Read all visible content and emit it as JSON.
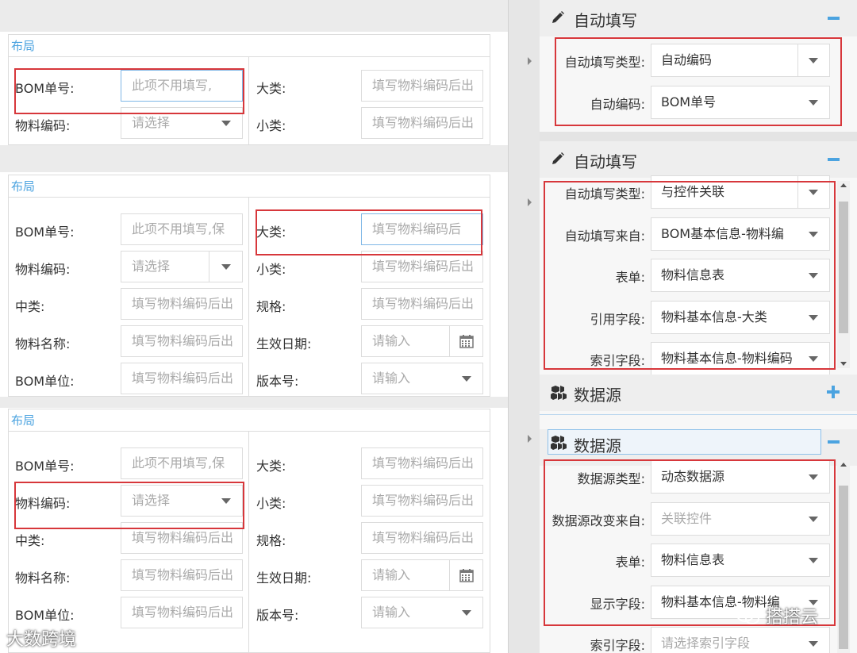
{
  "layout_title": "布局",
  "panels": [
    {
      "left": [
        {
          "label": "BOM单号:",
          "value": "此项不用填写,",
          "kind": "text",
          "focus": true
        },
        {
          "label": "物料编码:",
          "value": "请选择",
          "kind": "select"
        }
      ],
      "right": [
        {
          "label": "大类:",
          "value": "填写物料编码后出",
          "kind": "text"
        },
        {
          "label": "小类:",
          "value": "填写物料编码后出",
          "kind": "text"
        }
      ]
    },
    {
      "left": [
        {
          "label": "BOM单号:",
          "value": "此项不用填写,保",
          "kind": "text"
        },
        {
          "label": "物料编码:",
          "value": "请选择",
          "kind": "select-split"
        },
        {
          "label": "中类:",
          "value": "填写物料编码后出",
          "kind": "text"
        },
        {
          "label": "物料名称:",
          "value": "填写物料编码后出",
          "kind": "text"
        },
        {
          "label": "BOM单位:",
          "value": "填写物料编码后出",
          "kind": "text"
        }
      ],
      "right": [
        {
          "label": "大类:",
          "value": "填写物料编码后",
          "kind": "text",
          "focus": true
        },
        {
          "label": "小类:",
          "value": "填写物料编码后出",
          "kind": "text"
        },
        {
          "label": "规格:",
          "value": "填写物料编码后出",
          "kind": "text"
        },
        {
          "label": "生效日期:",
          "value": "请输入",
          "kind": "date"
        },
        {
          "label": "版本号:",
          "value": "请输入",
          "kind": "select"
        }
      ]
    },
    {
      "left": [
        {
          "label": "BOM单号:",
          "value": "此项不用填写,保",
          "kind": "text"
        },
        {
          "label": "物料编码:",
          "value": "请选择",
          "kind": "select"
        },
        {
          "label": "中类:",
          "value": "填写物料编码后出",
          "kind": "text"
        },
        {
          "label": "物料名称:",
          "value": "填写物料编码后出",
          "kind": "text"
        },
        {
          "label": "BOM单位:",
          "value": "填写物料编码后出",
          "kind": "text"
        }
      ],
      "right": [
        {
          "label": "大类:",
          "value": "填写物料编码后出",
          "kind": "text"
        },
        {
          "label": "小类:",
          "value": "填写物料编码后出",
          "kind": "text"
        },
        {
          "label": "规格:",
          "value": "填写物料编码后出",
          "kind": "text"
        },
        {
          "label": "生效日期:",
          "value": "请输入",
          "kind": "date"
        },
        {
          "label": "版本号:",
          "value": "请输入",
          "kind": "select"
        }
      ]
    }
  ],
  "right_panel": {
    "autofill_title": "自动填写",
    "datasource_title": "数据源",
    "autofill_1": [
      {
        "label": "自动填写类型:",
        "value": "自动编码",
        "split": true
      },
      {
        "label": "自动编码:",
        "value": "BOM单号"
      }
    ],
    "autofill_2": [
      {
        "label": "自动填写类型:",
        "value": "与控件关联",
        "split": true
      },
      {
        "label": "自动填写来自:",
        "value": "BOM基本信息-物料编"
      },
      {
        "label": "表单:",
        "value": "物料信息表"
      },
      {
        "label": "引用字段:",
        "value": "物料基本信息-大类"
      },
      {
        "label": "索引字段:",
        "value": "物料基本信息-物料编码"
      }
    ],
    "datasource_2": [
      {
        "label": "数据源类型:",
        "value": "动态数据源"
      },
      {
        "label": "数据源改变来自:",
        "value": "关联控件",
        "placeholder": true
      },
      {
        "label": "表单:",
        "value": "物料信息表"
      },
      {
        "label": "显示字段:",
        "value": "物料基本信息-物料编"
      },
      {
        "label": "索引字段:",
        "value": "请选择索引字段",
        "placeholder": true
      }
    ]
  },
  "watermarks": {
    "left": "大数跨境",
    "right": "搭搭云"
  },
  "colors": {
    "accent": "#4ba3e0",
    "highlight": "#d7373b"
  }
}
